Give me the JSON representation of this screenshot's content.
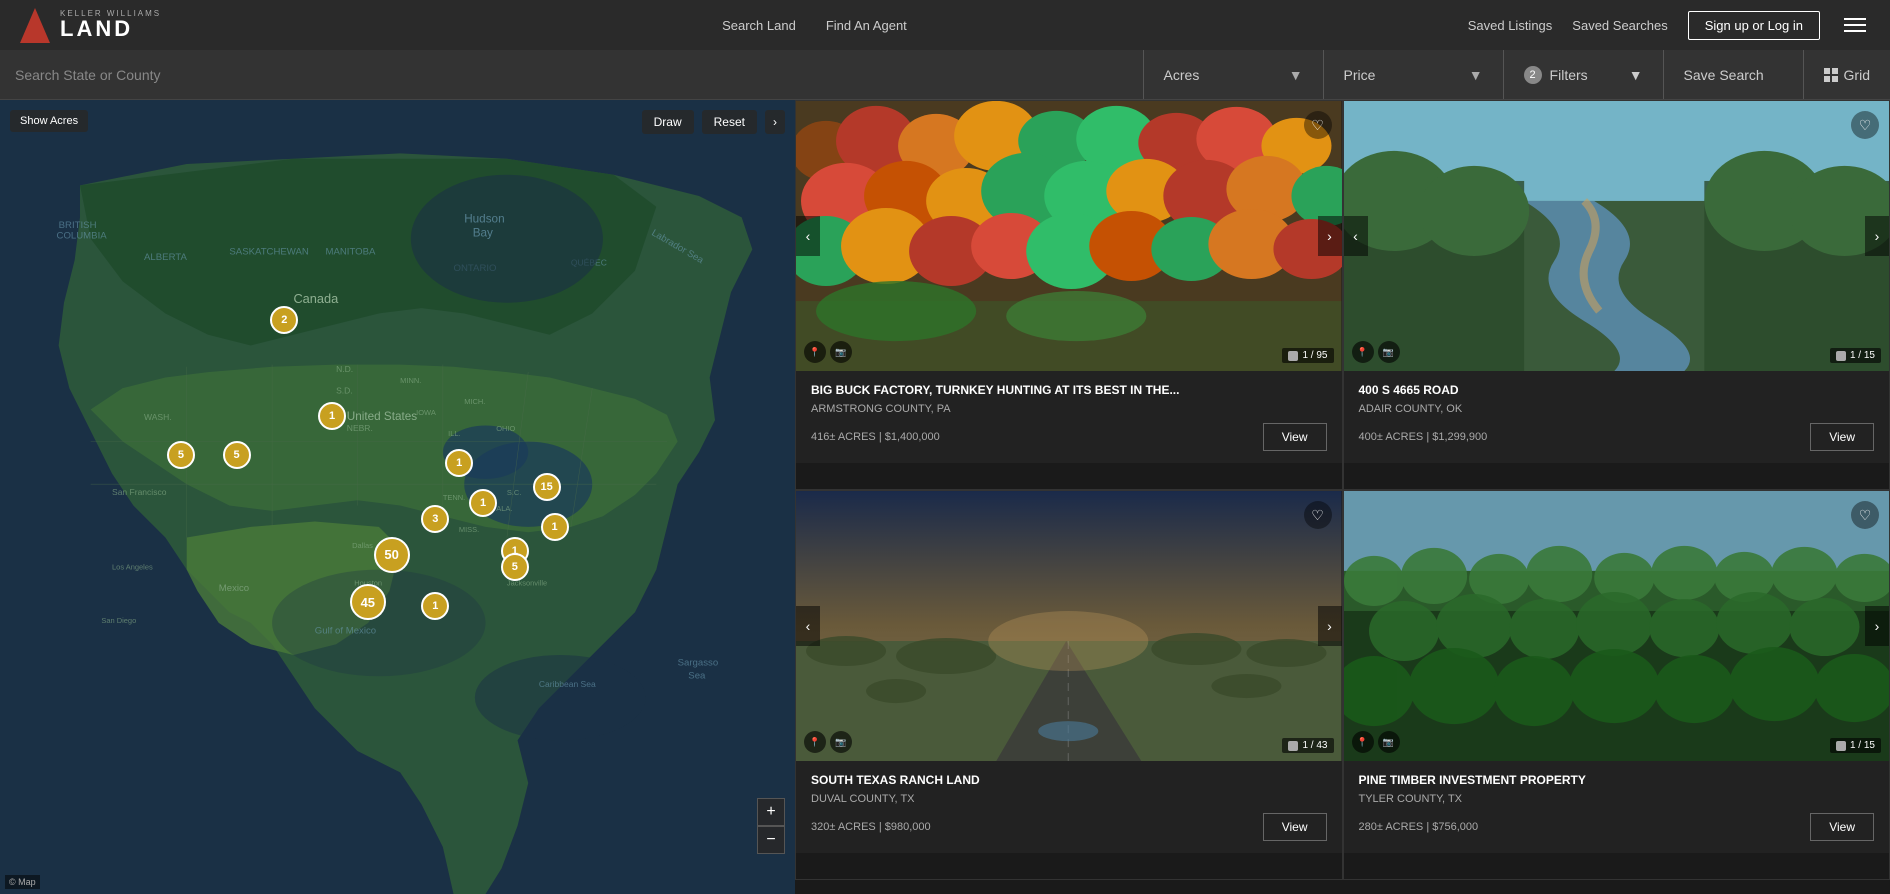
{
  "header": {
    "logo_kw": "KELLER WILLIAMS",
    "logo_land": "LAND",
    "nav": [
      {
        "label": "Search Land",
        "id": "search-land"
      },
      {
        "label": "Find An Agent",
        "id": "find-agent"
      }
    ],
    "saved": [
      {
        "label": "Saved Listings",
        "id": "saved-listings"
      },
      {
        "label": "Saved Searches",
        "id": "saved-searches"
      }
    ],
    "login_label": "Sign up or Log in",
    "menu_label": "Menu"
  },
  "search_bar": {
    "location_placeholder": "Search State or County",
    "acres_label": "Acres",
    "price_label": "Price",
    "filters_label": "Filters",
    "filter_count": "2",
    "save_search_label": "Save Search",
    "grid_label": "Grid"
  },
  "map": {
    "show_acres_label": "Show Acres",
    "draw_label": "Draw",
    "reset_label": "Reset",
    "clusters": [
      {
        "id": "c1",
        "count": "2",
        "top": "26%",
        "left": "34%"
      },
      {
        "id": "c2",
        "count": "15",
        "top": "47%",
        "left": "67%"
      },
      {
        "id": "c3",
        "count": "1",
        "top": "44%",
        "left": "56%"
      },
      {
        "id": "c4",
        "count": "3",
        "top": "52%",
        "left": "53%"
      },
      {
        "id": "c5",
        "count": "1",
        "top": "50%",
        "left": "59%"
      },
      {
        "id": "c6",
        "count": "1",
        "top": "55%",
        "left": "63%"
      },
      {
        "id": "c7",
        "count": "5",
        "top": "43%",
        "left": "22%"
      },
      {
        "id": "c8",
        "count": "5",
        "top": "43%",
        "left": "27%"
      },
      {
        "id": "c9",
        "count": "1",
        "top": "38%",
        "left": "39%"
      },
      {
        "id": "c10",
        "count": "50",
        "top": "55%",
        "left": "47%"
      },
      {
        "id": "c11",
        "count": "45",
        "top": "60%",
        "left": "44%"
      },
      {
        "id": "c12",
        "count": "5",
        "top": "58%",
        "left": "64%"
      },
      {
        "id": "c13",
        "count": "1",
        "top": "62%",
        "left": "53%"
      },
      {
        "id": "c14",
        "count": "1",
        "top": "52%",
        "left": "68%"
      }
    ]
  },
  "listings": [
    {
      "id": "listing1",
      "title": "BIG BUCK FACTORY, TURNKEY HUNTING AT ITS BEST IN THE...",
      "location": "ARMSTRONG COUNTY, PA",
      "acres": "416± ACRES",
      "price": "$1,400,000",
      "img_count": "1 / 95",
      "view_label": "View",
      "bg_color": "#4a6b3a",
      "bg_detail": "forest_autumn"
    },
    {
      "id": "listing2",
      "title": "400 S 4665 ROAD",
      "location": "ADAIR COUNTY, OK",
      "acres": "400± ACRES",
      "price": "$1,299,900",
      "img_count": "1 / 15",
      "view_label": "View",
      "bg_color": "#3a5a4a",
      "bg_detail": "river_forest"
    },
    {
      "id": "listing3",
      "title": "SOUTH TEXAS RANCH LAND",
      "location": "DUVAL COUNTY, TX",
      "acres": "320± ACRES",
      "price": "$980,000",
      "img_count": "1 / 43",
      "view_label": "View",
      "bg_color": "#5a6a3a",
      "bg_detail": "road_flatland"
    },
    {
      "id": "listing4",
      "title": "PINE TIMBER INVESTMENT PROPERTY",
      "location": "TYLER COUNTY, TX",
      "acres": "280± ACRES",
      "price": "$756,000",
      "img_count": "1 / 15",
      "view_label": "View",
      "bg_color": "#2a4a2a",
      "bg_detail": "pine_forest"
    }
  ]
}
